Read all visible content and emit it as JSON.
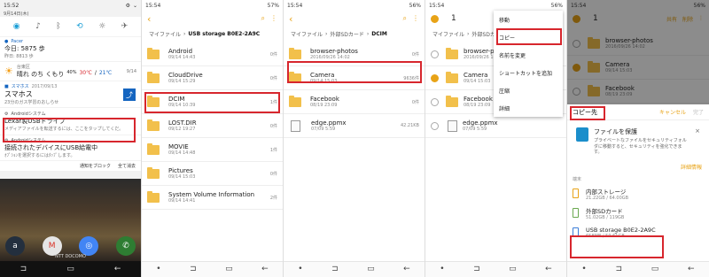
{
  "panel1": {
    "time": "15:52",
    "date": "9月14日(木)",
    "quick_settings": [
      "wifi-icon",
      "sound-icon",
      "bluetooth-icon",
      "rotate-icon",
      "flashlight-icon",
      "airplane-icon"
    ],
    "pacer": {
      "app": "Pacer",
      "today": "今日: 5875 歩",
      "yesterday": "昨日: 8813 歩"
    },
    "weather": {
      "location": "台東区",
      "text": "晴れ のち くもり",
      "humidity": "40%",
      "high": "30℃",
      "low": "21℃",
      "date": "9/14"
    },
    "sumaho": {
      "app": "スマホス",
      "date": "2017/09/13",
      "title": "スマホス",
      "desc": "23分のガス学習のおしらせ"
    },
    "android1": {
      "source": "Androidシステム",
      "title": "Lexar製USBドライブ",
      "desc": "メディアファイルを転送するには、ここをタップしてくだ。"
    },
    "android2": {
      "source": "Androidシステム",
      "title": "接続されたデバイスにUSB給電中",
      "desc": "ｵﾌﾟｼｮﾝを選択するにはﾀｯﾌﾟします。"
    },
    "actions": {
      "block": "通知をブロック",
      "clear": "全て消去"
    },
    "carrier": "NTT DOCOMO"
  },
  "panel2": {
    "time": "15:54",
    "battery": "57%",
    "breadcrumb": [
      "マイファイル",
      "USB storage B0E2-2A9C"
    ],
    "items": [
      {
        "name": "Android",
        "date": "09/14 14:43",
        "count": "0件"
      },
      {
        "name": "CloudDrive",
        "date": "09/14 15:29",
        "count": "0件"
      },
      {
        "name": "DCIM",
        "date": "09/14 10:39",
        "count": "1件"
      },
      {
        "name": "LOST.DIR",
        "date": "09/12 19:27",
        "count": "0件"
      },
      {
        "name": "MOVIE",
        "date": "09/14 14:48",
        "count": "1件"
      },
      {
        "name": "Pictures",
        "date": "09/14 15:03",
        "count": "0件"
      },
      {
        "name": "System Volume Information",
        "date": "09/14 14:41",
        "count": "2件"
      }
    ]
  },
  "panel3": {
    "time": "15:54",
    "battery": "56%",
    "breadcrumb": [
      "マイファイル",
      "外部SDカード",
      "DCIM"
    ],
    "items": [
      {
        "name": "browser-photos",
        "date": "2016/09/26 14:02",
        "count": "0件",
        "type": "folder"
      },
      {
        "name": "Camera",
        "date": "09/14 15:03",
        "count": "9636件",
        "type": "folder"
      },
      {
        "name": "Facebook",
        "date": "08/19 23:09",
        "count": "0件",
        "type": "folder"
      },
      {
        "name": "edge.ppmx",
        "date": "07/09 5:59",
        "count": "42.21KB",
        "type": "file"
      }
    ]
  },
  "panel4": {
    "time": "15:54",
    "battery": "56%",
    "selected_count": "1",
    "menu": [
      "移動",
      "コピー",
      "名前を変更",
      "ショートカットを追加",
      "圧縮",
      "詳細"
    ],
    "items": [
      {
        "name": "browser-photos",
        "date": "2016/09/26 14:02",
        "count": "0件",
        "checked": false,
        "type": "folder"
      },
      {
        "name": "Camera",
        "date": "09/14 15:03",
        "count": "9636件",
        "checked": true,
        "type": "folder"
      },
      {
        "name": "Facebook",
        "date": "08/19 23:09",
        "count": "0件",
        "checked": false,
        "type": "folder"
      },
      {
        "name": "edge.ppmx",
        "date": "07/09 5:59",
        "count": "42.21KB",
        "checked": false,
        "type": "file"
      }
    ]
  },
  "panel5": {
    "time": "15:54",
    "battery": "56%",
    "selected_count": "1",
    "top_actions": {
      "share": "共有",
      "delete": "削除"
    },
    "items": [
      {
        "name": "browser-photos",
        "date": "2016/09/26 14:02",
        "checked": false
      },
      {
        "name": "Camera",
        "date": "09/14 15:03",
        "checked": true
      },
      {
        "name": "Facebook",
        "date": "08/19 23:09",
        "checked": false
      }
    ],
    "sheet": {
      "title": "コピー先",
      "cancel": "キャンセル",
      "done": "完了",
      "protect_title": "ファイルを保護",
      "protect_desc": "プライベートなファイルをセキュリティフォルダに移動すると、セキュリティを強化できます。",
      "detail_link": "詳細情報",
      "section": "端末",
      "storages": [
        {
          "name": "内部ストレージ",
          "size": "21.22GB / 64.00GB"
        },
        {
          "name": "外部SDカード",
          "size": "51.02GB / 119GB"
        },
        {
          "name": "USB storage B0E2-2A9C",
          "size": "658MB / 59.61GB"
        }
      ]
    }
  }
}
